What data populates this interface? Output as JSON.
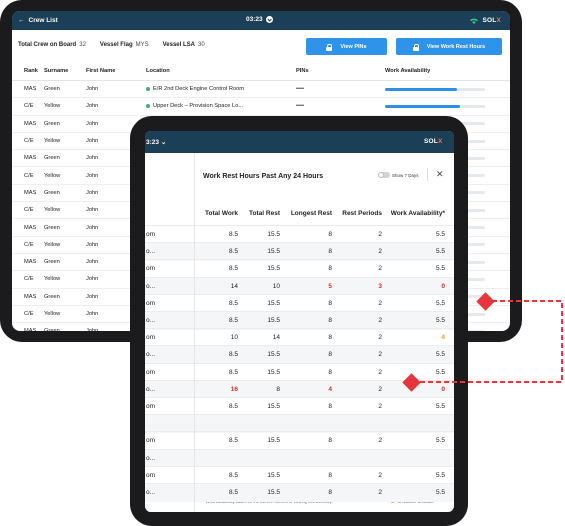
{
  "back": {
    "title": "Crew List",
    "time": "03:23",
    "brand": {
      "prefix": "SOL",
      "suffix": "X"
    },
    "stats": {
      "crew_label": "Total Crew on Board",
      "crew_value": "32",
      "flag_label": "Vessel Flag",
      "flag_value": "MYS",
      "lsa_label": "Vessel LSA",
      "lsa_value": "30"
    },
    "buttons": {
      "pins": "View PINs",
      "rest": "View Work Rest Hours"
    },
    "columns": [
      "Rank",
      "Surname",
      "First Name",
      "Location",
      "PINs",
      "Work Availability"
    ],
    "rows": [
      {
        "rank": "MAS",
        "surname": "Green",
        "first": "John",
        "location": "E/R 2nd Deck Engine Control Room",
        "pins": "••••",
        "avail": 0.72
      },
      {
        "rank": "C/E",
        "surname": "Yellow",
        "first": "John",
        "location": "Upper Deck – Provision Space Lo...",
        "pins": "••••",
        "avail": 0.75
      },
      {
        "rank": "MAS",
        "surname": "Green",
        "first": "John",
        "location": "E/R 2nd Deck Engine Control Room",
        "pins": "",
        "avail": 0.7
      },
      {
        "rank": "C/E",
        "surname": "Yellow",
        "first": "John",
        "location": "",
        "pins": "",
        "avail": 0.7
      },
      {
        "rank": "MAS",
        "surname": "Green",
        "first": "John",
        "location": "",
        "pins": "",
        "avail": 0.7
      },
      {
        "rank": "C/E",
        "surname": "Yellow",
        "first": "John",
        "location": "",
        "pins": "",
        "avail": 0.7
      },
      {
        "rank": "MAS",
        "surname": "Green",
        "first": "John",
        "location": "",
        "pins": "",
        "avail": 0.7
      },
      {
        "rank": "C/E",
        "surname": "Yellow",
        "first": "John",
        "location": "",
        "pins": "",
        "avail": 0.7
      },
      {
        "rank": "MAS",
        "surname": "Green",
        "first": "John",
        "location": "",
        "pins": "",
        "avail": 0.7
      },
      {
        "rank": "C/E",
        "surname": "Yellow",
        "first": "John",
        "location": "",
        "pins": "",
        "avail": 0.7
      },
      {
        "rank": "MAS",
        "surname": "Green",
        "first": "John",
        "location": "",
        "pins": "",
        "avail": 0.7
      },
      {
        "rank": "C/E",
        "surname": "Yellow",
        "first": "John",
        "location": "",
        "pins": "",
        "avail": 0.7
      },
      {
        "rank": "MAS",
        "surname": "Green",
        "first": "John",
        "location": "",
        "pins": "",
        "avail": 0.7
      },
      {
        "rank": "C/E",
        "surname": "Yellow",
        "first": "John",
        "location": "",
        "pins": "",
        "avail": 0.7
      },
      {
        "rank": "MAS",
        "surname": "Green",
        "first": "John",
        "location": "",
        "pins": "",
        "avail": 0.7
      }
    ]
  },
  "front": {
    "time": "3:23",
    "brand": {
      "prefix": "SOL",
      "suffix": "X"
    },
    "panel_title": "Work Rest Hours Past Any 24 Hours",
    "toggle_label": "Show 7 Days",
    "close": "✕",
    "columns": [
      "Total Work",
      "Total Rest",
      "Longest Rest",
      "Rest Periods",
      "Work Availability*"
    ],
    "rows": [
      {
        "loc": "om",
        "vals": [
          "8.5",
          "15.5",
          "8",
          "2",
          "5.5"
        ],
        "flags": [
          "",
          "",
          "",
          "",
          ""
        ]
      },
      {
        "loc": "o...",
        "vals": [
          "8.5",
          "15.5",
          "8",
          "2",
          "5.5"
        ],
        "flags": [
          "",
          "",
          "",
          "",
          ""
        ]
      },
      {
        "loc": "om",
        "vals": [
          "8.5",
          "15.5",
          "8",
          "2",
          "5.5"
        ],
        "flags": [
          "",
          "",
          "",
          "",
          ""
        ]
      },
      {
        "loc": "o...",
        "vals": [
          "14",
          "10",
          "5",
          "3",
          "0"
        ],
        "flags": [
          "",
          "",
          "red",
          "red",
          "red"
        ]
      },
      {
        "loc": "om",
        "vals": [
          "8.5",
          "15.5",
          "8",
          "2",
          "5.5"
        ],
        "flags": [
          "",
          "",
          "",
          "",
          ""
        ]
      },
      {
        "loc": "o...",
        "vals": [
          "8.5",
          "15.5",
          "8",
          "2",
          "5.5"
        ],
        "flags": [
          "",
          "",
          "",
          "",
          ""
        ]
      },
      {
        "loc": "om",
        "vals": [
          "10",
          "14",
          "8",
          "2",
          "4"
        ],
        "flags": [
          "",
          "",
          "",
          "",
          "amb"
        ]
      },
      {
        "loc": "o...",
        "vals": [
          "8.5",
          "15.5",
          "8",
          "2",
          "5.5"
        ],
        "flags": [
          "",
          "",
          "",
          "",
          ""
        ]
      },
      {
        "loc": "om",
        "vals": [
          "8.5",
          "15.5",
          "8",
          "2",
          "5.5"
        ],
        "flags": [
          "",
          "",
          "",
          "",
          ""
        ]
      },
      {
        "loc": "o...",
        "vals": [
          "16",
          "8",
          "4",
          "2",
          "0"
        ],
        "flags": [
          "red",
          "",
          "red",
          "",
          "red"
        ]
      },
      {
        "loc": "om",
        "vals": [
          "8.5",
          "15.5",
          "8",
          "2",
          "5.5"
        ],
        "flags": [
          "",
          "",
          "",
          "",
          ""
        ]
      },
      {
        "loc": "",
        "vals": [
          "",
          "",
          "",
          "",
          ""
        ],
        "flags": [
          "",
          "",
          "",
          "",
          ""
        ]
      },
      {
        "loc": "om",
        "vals": [
          "8.5",
          "15.5",
          "8",
          "2",
          "5.5"
        ],
        "flags": [
          "",
          "",
          "",
          "",
          ""
        ]
      },
      {
        "loc": "o...",
        "vals": [
          "",
          "",
          "",
          "",
          ""
        ],
        "flags": [
          "",
          "",
          "",
          "",
          ""
        ]
      },
      {
        "loc": "om",
        "vals": [
          "8.5",
          "15.5",
          "8",
          "2",
          "5.5"
        ],
        "flags": [
          "",
          "",
          "",
          "",
          ""
        ]
      },
      {
        "loc": "o...",
        "vals": [
          "8.5",
          "15.5",
          "8",
          "2",
          "5.5"
        ],
        "flags": [
          "",
          "",
          "",
          "",
          ""
        ]
      }
    ],
    "footnote": "* Work Availability based on the current moment of viewing this summary.",
    "legend": "To balance workload"
  },
  "colors": {
    "header": "#1a3f57",
    "accent": "#2e93e9",
    "alert": "#d0302a",
    "warn": "#f1a324",
    "marker": "#e8353b"
  }
}
